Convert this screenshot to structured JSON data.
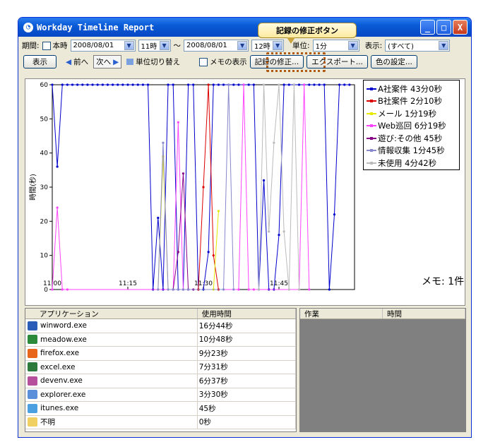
{
  "window": {
    "title": "Workday Timeline Report",
    "min": "_",
    "max": "□",
    "close": "X"
  },
  "callout": "記録の修正ボタン",
  "toolbar1": {
    "period_label": "期間:",
    "today_label": "本時",
    "start_date": "2008/08/01",
    "start_hour": "11時",
    "tilde": "〜",
    "end_date": "2008/08/01",
    "end_hour": "12時",
    "unit_label": "単位:",
    "unit_value": "1分",
    "display_label": "表示:",
    "display_value": "(すべて)"
  },
  "toolbar2": {
    "show": "表示",
    "prev": "前へ",
    "next": "次へ",
    "toggle_unit": "単位切り替え",
    "memo_show": "メモの表示",
    "edit_record": "記録の修正...",
    "export": "エクスポート...",
    "color_settings": "色の設定..."
  },
  "chart_data": {
    "type": "line",
    "ylabel": "時間(秒)",
    "ylim": [
      0,
      60
    ],
    "yticks": [
      "0",
      "10",
      "20",
      "30",
      "40",
      "50",
      "60"
    ],
    "xticks": [
      "11:00",
      "11:15",
      "11:30",
      "11:45"
    ],
    "xlim": [
      0,
      60
    ],
    "series": [
      {
        "name": "A社案件 43分0秒",
        "color": "#0000cc",
        "x": [
          0,
          1,
          2,
          3,
          4,
          5,
          6,
          7,
          8,
          9,
          10,
          11,
          12,
          13,
          14,
          15,
          16,
          17,
          18,
          19,
          20,
          21,
          22,
          23,
          24,
          25,
          26,
          27,
          28,
          29,
          30,
          31,
          32,
          33,
          34,
          35,
          36,
          37,
          38,
          39,
          40,
          41,
          42,
          43,
          44,
          45,
          46,
          47,
          48,
          49,
          50,
          51,
          52,
          53,
          54,
          55,
          56,
          57,
          58,
          59
        ],
        "y": [
          60,
          36,
          60,
          60,
          60,
          60,
          60,
          60,
          60,
          60,
          60,
          60,
          60,
          60,
          60,
          60,
          60,
          60,
          60,
          60,
          0,
          21,
          0,
          60,
          60,
          0,
          0,
          60,
          60,
          0,
          0,
          11,
          60,
          60,
          60,
          60,
          60,
          60,
          60,
          60,
          60,
          0,
          32,
          0,
          0,
          16,
          60,
          60,
          60,
          60,
          60,
          60,
          60,
          60,
          60,
          0,
          22,
          60,
          60,
          60
        ]
      },
      {
        "name": "B社案件 2分10秒",
        "color": "#dd0000",
        "x": [
          29,
          30,
          31,
          32,
          33
        ],
        "y": [
          0,
          30,
          60,
          10,
          0
        ]
      },
      {
        "name": "メール 1分19秒",
        "color": "#e8e800",
        "x": [
          21,
          22,
          23,
          32,
          33
        ],
        "y": [
          0,
          39,
          0,
          0,
          23
        ]
      },
      {
        "name": "Web巡回 6分19秒",
        "color": "#ff44ff",
        "x": [
          0,
          1,
          2,
          3,
          24,
          25,
          26,
          27,
          37,
          38,
          39,
          40,
          49,
          50,
          51
        ],
        "y": [
          0,
          24,
          0,
          0,
          0,
          49,
          0,
          0,
          0,
          60,
          0,
          0,
          0,
          60,
          0
        ]
      },
      {
        "name": "遊び:その他 45秒",
        "color": "#880088",
        "x": [
          24,
          25,
          26,
          27,
          28
        ],
        "y": [
          0,
          11,
          34,
          0,
          0
        ]
      },
      {
        "name": "情報収集 1分45秒",
        "color": "#8888cc",
        "x": [
          21,
          22,
          23,
          24,
          25,
          26,
          27,
          34,
          35,
          36
        ],
        "y": [
          0,
          43,
          0,
          0,
          0,
          0,
          0,
          0,
          60,
          0
        ]
      },
      {
        "name": "未使用 4分42秒",
        "color": "#bbbbbb",
        "x": [
          41,
          42,
          43,
          44,
          45,
          46,
          47,
          48,
          49
        ],
        "y": [
          0,
          60,
          17,
          43,
          60,
          17,
          0,
          60,
          0
        ]
      }
    ]
  },
  "memo_text": "メモ: 1件",
  "apps": {
    "headers": [
      "アプリケーション",
      "使用時間"
    ],
    "rows": [
      {
        "name": "winword.exe",
        "time": "16分44秒",
        "icon": "word-icon",
        "color": "#2b5db8"
      },
      {
        "name": "meadow.exe",
        "time": "10分48秒",
        "icon": "meadow-icon",
        "color": "#2a8a3a"
      },
      {
        "name": "firefox.exe",
        "time": "9分23秒",
        "icon": "firefox-icon",
        "color": "#e8661a"
      },
      {
        "name": "excel.exe",
        "time": "7分31秒",
        "icon": "excel-icon",
        "color": "#2c7a3c"
      },
      {
        "name": "devenv.exe",
        "time": "6分37秒",
        "icon": "devenv-icon",
        "color": "#b7509c"
      },
      {
        "name": "explorer.exe",
        "time": "3分30秒",
        "icon": "explorer-icon",
        "color": "#5b8fd9"
      },
      {
        "name": "itunes.exe",
        "time": "45秒",
        "icon": "itunes-icon",
        "color": "#4aa0e0"
      },
      {
        "name": "不明",
        "time": "0秒",
        "icon": "folder-icon",
        "color": "#f0d060"
      }
    ]
  },
  "tasks": {
    "headers": [
      "作業",
      "時間"
    ]
  }
}
